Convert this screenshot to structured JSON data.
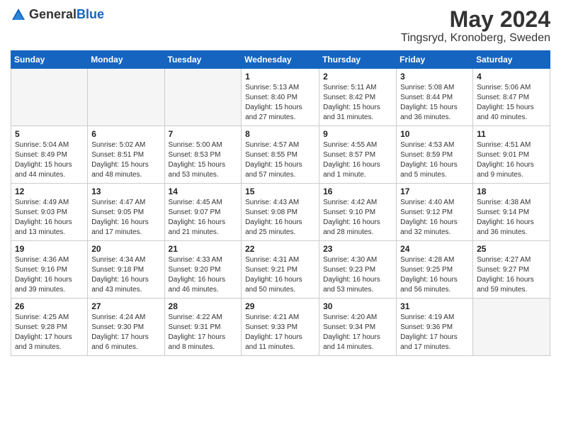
{
  "header": {
    "logo_general": "General",
    "logo_blue": "Blue",
    "month_title": "May 2024",
    "location": "Tingsryd, Kronoberg, Sweden"
  },
  "days_of_week": [
    "Sunday",
    "Monday",
    "Tuesday",
    "Wednesday",
    "Thursday",
    "Friday",
    "Saturday"
  ],
  "weeks": [
    [
      {
        "day": "",
        "info": ""
      },
      {
        "day": "",
        "info": ""
      },
      {
        "day": "",
        "info": ""
      },
      {
        "day": "1",
        "info": "Sunrise: 5:13 AM\nSunset: 8:40 PM\nDaylight: 15 hours\nand 27 minutes."
      },
      {
        "day": "2",
        "info": "Sunrise: 5:11 AM\nSunset: 8:42 PM\nDaylight: 15 hours\nand 31 minutes."
      },
      {
        "day": "3",
        "info": "Sunrise: 5:08 AM\nSunset: 8:44 PM\nDaylight: 15 hours\nand 36 minutes."
      },
      {
        "day": "4",
        "info": "Sunrise: 5:06 AM\nSunset: 8:47 PM\nDaylight: 15 hours\nand 40 minutes."
      }
    ],
    [
      {
        "day": "5",
        "info": "Sunrise: 5:04 AM\nSunset: 8:49 PM\nDaylight: 15 hours\nand 44 minutes."
      },
      {
        "day": "6",
        "info": "Sunrise: 5:02 AM\nSunset: 8:51 PM\nDaylight: 15 hours\nand 48 minutes."
      },
      {
        "day": "7",
        "info": "Sunrise: 5:00 AM\nSunset: 8:53 PM\nDaylight: 15 hours\nand 53 minutes."
      },
      {
        "day": "8",
        "info": "Sunrise: 4:57 AM\nSunset: 8:55 PM\nDaylight: 15 hours\nand 57 minutes."
      },
      {
        "day": "9",
        "info": "Sunrise: 4:55 AM\nSunset: 8:57 PM\nDaylight: 16 hours\nand 1 minute."
      },
      {
        "day": "10",
        "info": "Sunrise: 4:53 AM\nSunset: 8:59 PM\nDaylight: 16 hours\nand 5 minutes."
      },
      {
        "day": "11",
        "info": "Sunrise: 4:51 AM\nSunset: 9:01 PM\nDaylight: 16 hours\nand 9 minutes."
      }
    ],
    [
      {
        "day": "12",
        "info": "Sunrise: 4:49 AM\nSunset: 9:03 PM\nDaylight: 16 hours\nand 13 minutes."
      },
      {
        "day": "13",
        "info": "Sunrise: 4:47 AM\nSunset: 9:05 PM\nDaylight: 16 hours\nand 17 minutes."
      },
      {
        "day": "14",
        "info": "Sunrise: 4:45 AM\nSunset: 9:07 PM\nDaylight: 16 hours\nand 21 minutes."
      },
      {
        "day": "15",
        "info": "Sunrise: 4:43 AM\nSunset: 9:08 PM\nDaylight: 16 hours\nand 25 minutes."
      },
      {
        "day": "16",
        "info": "Sunrise: 4:42 AM\nSunset: 9:10 PM\nDaylight: 16 hours\nand 28 minutes."
      },
      {
        "day": "17",
        "info": "Sunrise: 4:40 AM\nSunset: 9:12 PM\nDaylight: 16 hours\nand 32 minutes."
      },
      {
        "day": "18",
        "info": "Sunrise: 4:38 AM\nSunset: 9:14 PM\nDaylight: 16 hours\nand 36 minutes."
      }
    ],
    [
      {
        "day": "19",
        "info": "Sunrise: 4:36 AM\nSunset: 9:16 PM\nDaylight: 16 hours\nand 39 minutes."
      },
      {
        "day": "20",
        "info": "Sunrise: 4:34 AM\nSunset: 9:18 PM\nDaylight: 16 hours\nand 43 minutes."
      },
      {
        "day": "21",
        "info": "Sunrise: 4:33 AM\nSunset: 9:20 PM\nDaylight: 16 hours\nand 46 minutes."
      },
      {
        "day": "22",
        "info": "Sunrise: 4:31 AM\nSunset: 9:21 PM\nDaylight: 16 hours\nand 50 minutes."
      },
      {
        "day": "23",
        "info": "Sunrise: 4:30 AM\nSunset: 9:23 PM\nDaylight: 16 hours\nand 53 minutes."
      },
      {
        "day": "24",
        "info": "Sunrise: 4:28 AM\nSunset: 9:25 PM\nDaylight: 16 hours\nand 56 minutes."
      },
      {
        "day": "25",
        "info": "Sunrise: 4:27 AM\nSunset: 9:27 PM\nDaylight: 16 hours\nand 59 minutes."
      }
    ],
    [
      {
        "day": "26",
        "info": "Sunrise: 4:25 AM\nSunset: 9:28 PM\nDaylight: 17 hours\nand 3 minutes."
      },
      {
        "day": "27",
        "info": "Sunrise: 4:24 AM\nSunset: 9:30 PM\nDaylight: 17 hours\nand 6 minutes."
      },
      {
        "day": "28",
        "info": "Sunrise: 4:22 AM\nSunset: 9:31 PM\nDaylight: 17 hours\nand 8 minutes."
      },
      {
        "day": "29",
        "info": "Sunrise: 4:21 AM\nSunset: 9:33 PM\nDaylight: 17 hours\nand 11 minutes."
      },
      {
        "day": "30",
        "info": "Sunrise: 4:20 AM\nSunset: 9:34 PM\nDaylight: 17 hours\nand 14 minutes."
      },
      {
        "day": "31",
        "info": "Sunrise: 4:19 AM\nSunset: 9:36 PM\nDaylight: 17 hours\nand 17 minutes."
      },
      {
        "day": "",
        "info": ""
      }
    ]
  ]
}
